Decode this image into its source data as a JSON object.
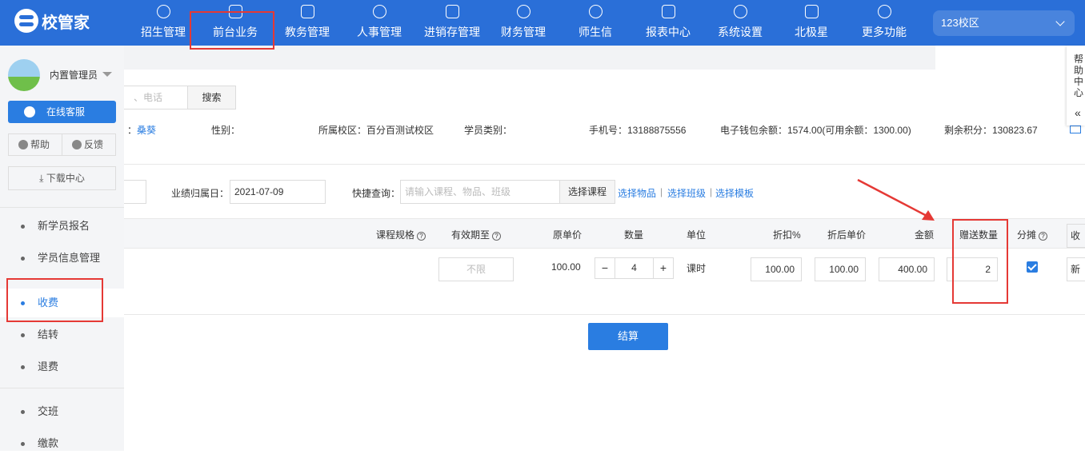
{
  "app": {
    "name": "校管家"
  },
  "topnav": {
    "items": [
      {
        "label": "招生管理",
        "icon": "person-add-icon"
      },
      {
        "label": "前台业务",
        "icon": "monitor-icon"
      },
      {
        "label": "教务管理",
        "icon": "book-icon"
      },
      {
        "label": "人事管理",
        "icon": "person-icon"
      },
      {
        "label": "进销存管理",
        "icon": "exchange-icon"
      },
      {
        "label": "财务管理",
        "icon": "finance-icon"
      },
      {
        "label": "师生信",
        "icon": "chat-icon"
      },
      {
        "label": "报表中心",
        "icon": "report-icon"
      },
      {
        "label": "系统设置",
        "icon": "gear-icon"
      },
      {
        "label": "北极星",
        "icon": "star-icon"
      },
      {
        "label": "更多功能",
        "icon": "more-icon"
      }
    ],
    "campus": "123校区"
  },
  "sidebar": {
    "username": "内置管理员",
    "service_btn": "在线客服",
    "help_btn": "帮助",
    "feedback_btn": "反馈",
    "download_btn": "下载中心",
    "menu": [
      {
        "label": "新学员报名"
      },
      {
        "label": "学员信息管理"
      },
      {
        "label": "收费",
        "active": true
      },
      {
        "label": "结转"
      },
      {
        "label": "退费"
      },
      {
        "label": "交班"
      },
      {
        "label": "缴款"
      }
    ]
  },
  "search": {
    "placeholder": "、电话",
    "button": "搜索"
  },
  "student_info": {
    "name_prefix": "：",
    "name": "桑葵",
    "gender_label": "性别：",
    "campus": "所属校区：百分百测试校区",
    "type_label": "学员类别：",
    "phone": "手机号：13188875556",
    "wallet": "电子钱包余额：1574.00(可用余额：1300.00)",
    "points": "剩余积分：130823.67"
  },
  "filters": {
    "date_label": "业绩归属日：",
    "date_value": "2021-07-09",
    "quick_label": "快捷查询：",
    "quick_placeholder": "请输入课程、物品、班级",
    "course_btn": "选择课程",
    "link_items": "选择物品",
    "link_class": "选择班级",
    "link_template": "选择模板",
    "separator": "|"
  },
  "table": {
    "headers": {
      "spec": "课程规格",
      "valid_until": "有效期至",
      "unit_price": "原单价",
      "quantity": "数量",
      "unit": "单位",
      "discount": "折扣%",
      "discounted_price": "折后单价",
      "amount": "金额",
      "gift_qty": "赠送数量",
      "split": "分摊",
      "charge_prefix": "收"
    },
    "row": {
      "valid_until": "不限",
      "unit_price": "100.00",
      "quantity": "4",
      "minus": "−",
      "plus": "+",
      "unit": "课时",
      "discount": "100.00",
      "discounted_price": "100.00",
      "amount": "400.00",
      "gift_qty": "2",
      "new_prefix": "新"
    }
  },
  "settle_btn": "结算",
  "help_panel": {
    "chars": [
      "帮",
      "助",
      "中",
      "心"
    ],
    "arrow": "«"
  },
  "question_mark": "?",
  "colors": {
    "primary": "#2a6fd8",
    "accent": "#2a7de1",
    "highlight": "#e53935"
  }
}
